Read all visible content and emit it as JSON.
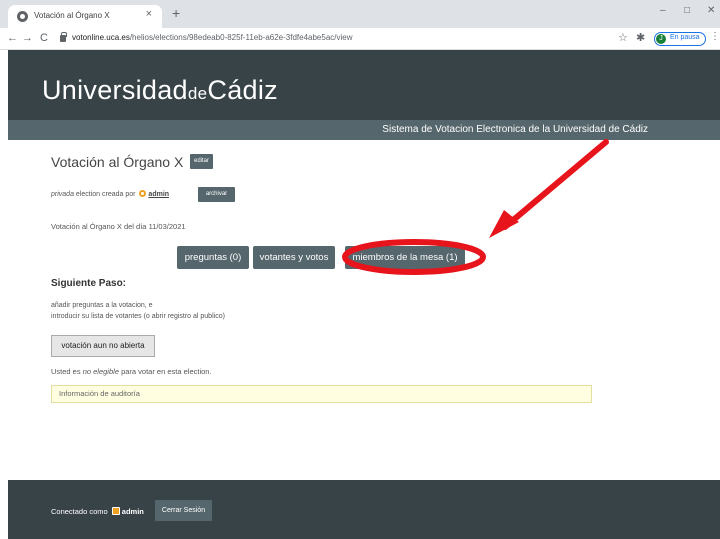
{
  "browser": {
    "tab_title": "Votación al Órgano X",
    "tab_close": "×",
    "new_tab": "+",
    "minimize": "–",
    "maximize": "□",
    "close": "✕",
    "back": "←",
    "forward": "→",
    "reload": "C",
    "url_domain": "votonline.uca.es",
    "url_path": "/helios/elections/98edeab0-825f-11eb-a62e-3fdfe4abe5ac/view",
    "profile_initial": "J",
    "profile_status": "En pausa"
  },
  "site": {
    "logo_part1": "Universidad",
    "logo_part2": "de",
    "logo_part3": "Cádiz",
    "subtitle": "Sistema de Votacion Electronica de la Universidad de Cádiz"
  },
  "election": {
    "title": "Votación al Órgano X",
    "edit_label": "editar",
    "privacy": "privada",
    "created_by": "election creada por",
    "admin": "admin",
    "archive_label": "archivar",
    "description": "Votación al Órgano X del día 11/03/2021",
    "tabs": [
      {
        "label": "preguntas (0)"
      },
      {
        "label": "votantes y votos"
      },
      {
        "label": "miembros de la mesa (1)"
      }
    ],
    "next_step_heading": "Siguiente Paso:",
    "instruction_1": "añadir preguntas a la votacion, e",
    "instruction_2": "introducir su lista de votantes (o abrir registro al publico)",
    "not_open_label": "votación aun no abierta",
    "eligible_prefix": "Usted es",
    "eligible_em": "no elegible",
    "eligible_suffix": "para votar en esta election.",
    "audit_label": "Información de auditoría"
  },
  "footer": {
    "connected_as": "Conectado como",
    "admin": "admin",
    "logout_label": "Cerrar Sesión"
  },
  "colors": {
    "header_bg": "#384348",
    "button_bg": "#56666d",
    "annotation": "#e8141c"
  }
}
